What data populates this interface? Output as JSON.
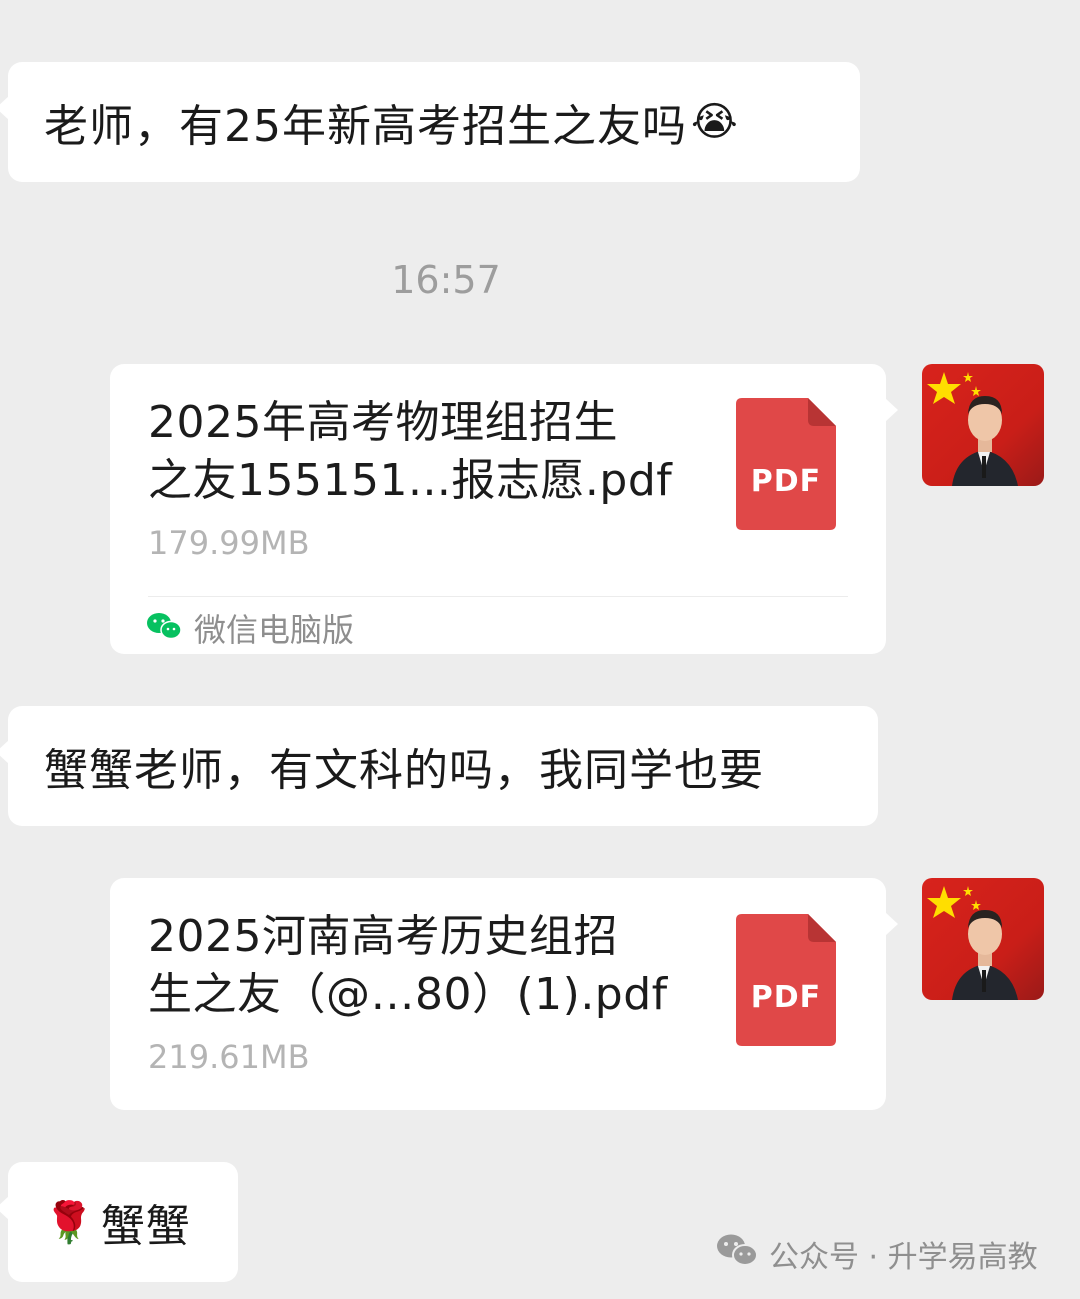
{
  "messages": [
    {
      "side": "left",
      "text": "老师，有25年新高考招生之友吗",
      "emoji": "😭"
    },
    {
      "timestamp": "16:57"
    },
    {
      "side": "right",
      "type": "file",
      "file_name_line1": "2025年高考物理组招生",
      "file_name_line2": "之友155151...报志愿.pdf",
      "file_size": "179.99MB",
      "file_type": "PDF",
      "source": "微信电脑版",
      "source_icon": "wechat-icon"
    },
    {
      "side": "left",
      "text": "蟹蟹老师，有文科的吗，我同学也要"
    },
    {
      "side": "right",
      "type": "file",
      "file_name_line1": "2025河南高考历史组招",
      "file_name_line2": "生之友（@…80）(1).pdf",
      "file_size": "219.61MB",
      "file_type": "PDF"
    },
    {
      "side": "left",
      "text": "蟹蟹",
      "emoji": "🌹"
    }
  ],
  "watermark": {
    "text": "公众号 · 升学易高教",
    "icon": "wechat-icon"
  },
  "colors": {
    "background": "#ededed",
    "bubble": "#ffffff",
    "pdf": "#e04848",
    "wechat": "#07c160"
  }
}
